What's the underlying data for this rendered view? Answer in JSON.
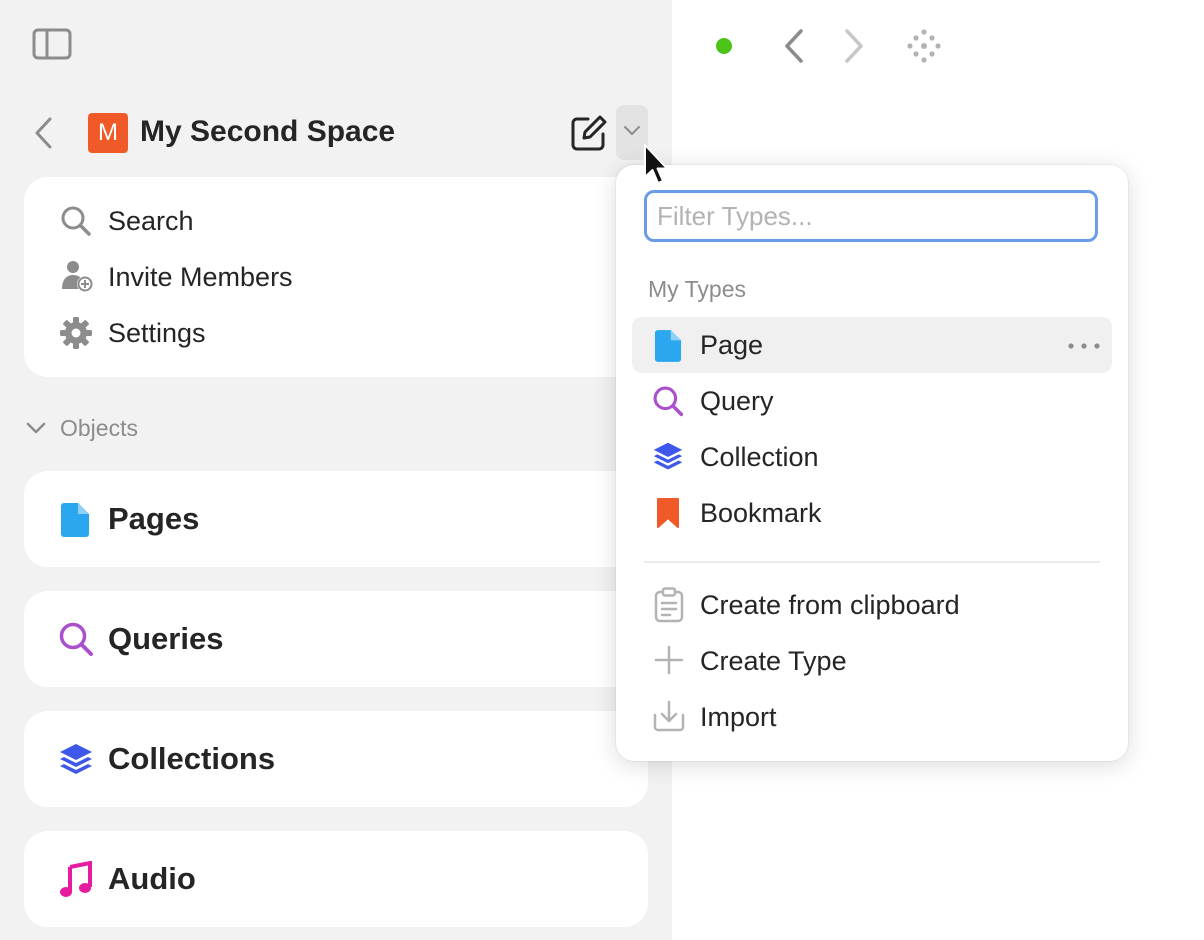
{
  "space": {
    "avatar_letter": "M",
    "name": "My Second Space",
    "avatar_color": "#f05a28"
  },
  "toolbar": {
    "sync_status_color": "#4cc417"
  },
  "menu": {
    "search_label": "Search",
    "invite_label": "Invite Members",
    "settings_label": "Settings"
  },
  "objects_section": {
    "label": "Objects",
    "items": [
      {
        "label": "Pages",
        "icon": "page-icon",
        "color": "#2aa7ee"
      },
      {
        "label": "Queries",
        "icon": "query-icon",
        "color": "#ab50cc"
      },
      {
        "label": "Collections",
        "icon": "collection-icon",
        "color": "#3e58eb"
      },
      {
        "label": "Audio",
        "icon": "audio-icon",
        "color": "#e51ca0"
      }
    ]
  },
  "type_popup": {
    "filter_placeholder": "Filter Types...",
    "section_label": "My Types",
    "types": [
      {
        "label": "Page",
        "icon": "page-icon",
        "color": "#2aa7ee"
      },
      {
        "label": "Query",
        "icon": "query-icon",
        "color": "#ab50cc"
      },
      {
        "label": "Collection",
        "icon": "collection-icon",
        "color": "#3e58eb"
      },
      {
        "label": "Bookmark",
        "icon": "bookmark-icon",
        "color": "#f05a28"
      }
    ],
    "actions": [
      {
        "label": "Create from clipboard",
        "icon": "clipboard-icon"
      },
      {
        "label": "Create Type",
        "icon": "plus-icon"
      },
      {
        "label": "Import",
        "icon": "import-icon"
      }
    ]
  }
}
